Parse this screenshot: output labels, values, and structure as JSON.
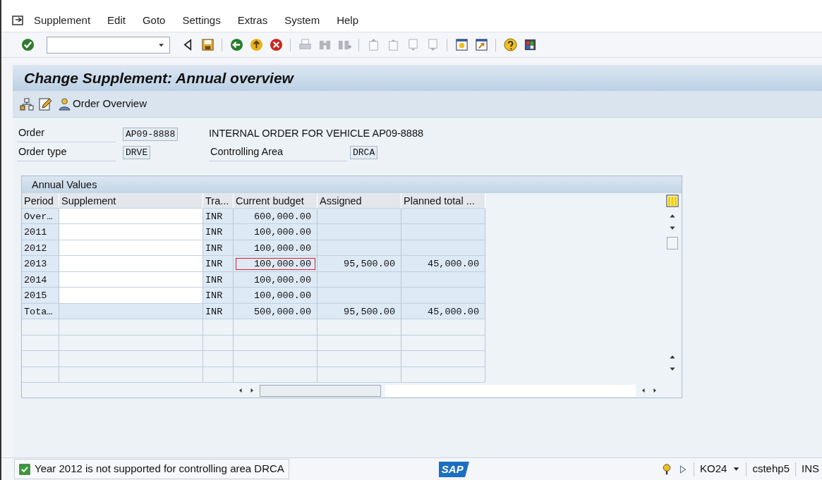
{
  "menu": [
    {
      "label": "Supplement"
    },
    {
      "label": "Edit"
    },
    {
      "label": "Goto"
    },
    {
      "label": "Settings"
    },
    {
      "label": "Extras"
    },
    {
      "label": "System"
    },
    {
      "label": "Help"
    }
  ],
  "toolbar": {
    "buttons": [
      {
        "kind": "enter",
        "disabled": false
      },
      {
        "kind": "command"
      },
      {
        "kind": "collapse",
        "disabled": false
      },
      {
        "kind": "save",
        "disabled": false
      },
      {
        "kind": "sep"
      },
      {
        "kind": "back",
        "disabled": false
      },
      {
        "kind": "exit",
        "disabled": false
      },
      {
        "kind": "cancel",
        "disabled": false
      },
      {
        "kind": "sep"
      },
      {
        "kind": "print",
        "disabled": true
      },
      {
        "kind": "find",
        "disabled": true
      },
      {
        "kind": "find_next",
        "disabled": true
      },
      {
        "kind": "sep"
      },
      {
        "kind": "first_page",
        "disabled": true
      },
      {
        "kind": "prev_page",
        "disabled": true
      },
      {
        "kind": "next_page",
        "disabled": true
      },
      {
        "kind": "last_page",
        "disabled": true
      },
      {
        "kind": "sep"
      },
      {
        "kind": "new_session",
        "disabled": false
      },
      {
        "kind": "shortcut",
        "disabled": false
      },
      {
        "kind": "sep"
      },
      {
        "kind": "help",
        "disabled": false
      },
      {
        "kind": "layout",
        "disabled": false
      }
    ]
  },
  "title": "Change Supplement: Annual overview",
  "app_toolbar": [
    {
      "kind": "hierarchy"
    },
    {
      "kind": "edit"
    },
    {
      "kind": "person",
      "label": "Order Overview"
    }
  ],
  "header": {
    "order_label": "Order",
    "order": "AP09-8888",
    "order_text": "INTERNAL ORDER FOR VEHICLE AP09-8888",
    "order_type_label": "Order type",
    "order_type": "DRVE",
    "controlling_area_label": "Controlling Area",
    "controlling_area": "DRCA"
  },
  "table": {
    "title": "Annual Values",
    "columns": [
      "Period",
      "Supplement",
      "Tra...",
      "Current budget",
      "Assigned",
      "Planned total ..."
    ],
    "rows": [
      {
        "period": "Over…",
        "editable": true,
        "currency": "INR",
        "current_budget": "600,000.00",
        "focused": false
      },
      {
        "period": "2011",
        "editable": true,
        "currency": "INR",
        "current_budget": "100,000.00",
        "focused": false
      },
      {
        "period": "2012",
        "editable": true,
        "currency": "INR",
        "current_budget": "100,000.00",
        "focused": false
      },
      {
        "period": "2013",
        "editable": true,
        "currency": "INR",
        "current_budget": "100,000.00",
        "assigned": "95,500.00",
        "planned_total": "45,000.00",
        "focused": true
      },
      {
        "period": "2014",
        "editable": true,
        "currency": "INR",
        "current_budget": "100,000.00",
        "focused": false
      },
      {
        "period": "2015",
        "editable": true,
        "currency": "INR",
        "current_budget": "100,000.00",
        "focused": false
      },
      {
        "period": "Tota…",
        "editable": false,
        "currency": "INR",
        "current_budget": "500,000.00",
        "assigned": "95,500.00",
        "planned_total": "45,000.00",
        "focused": false
      }
    ]
  },
  "status_bar": {
    "logo": "SAP",
    "message": "Year 2012 is not supported for controlling area DRCA",
    "transaction": "KO24",
    "user": "cstehp5",
    "mode": "INS"
  }
}
